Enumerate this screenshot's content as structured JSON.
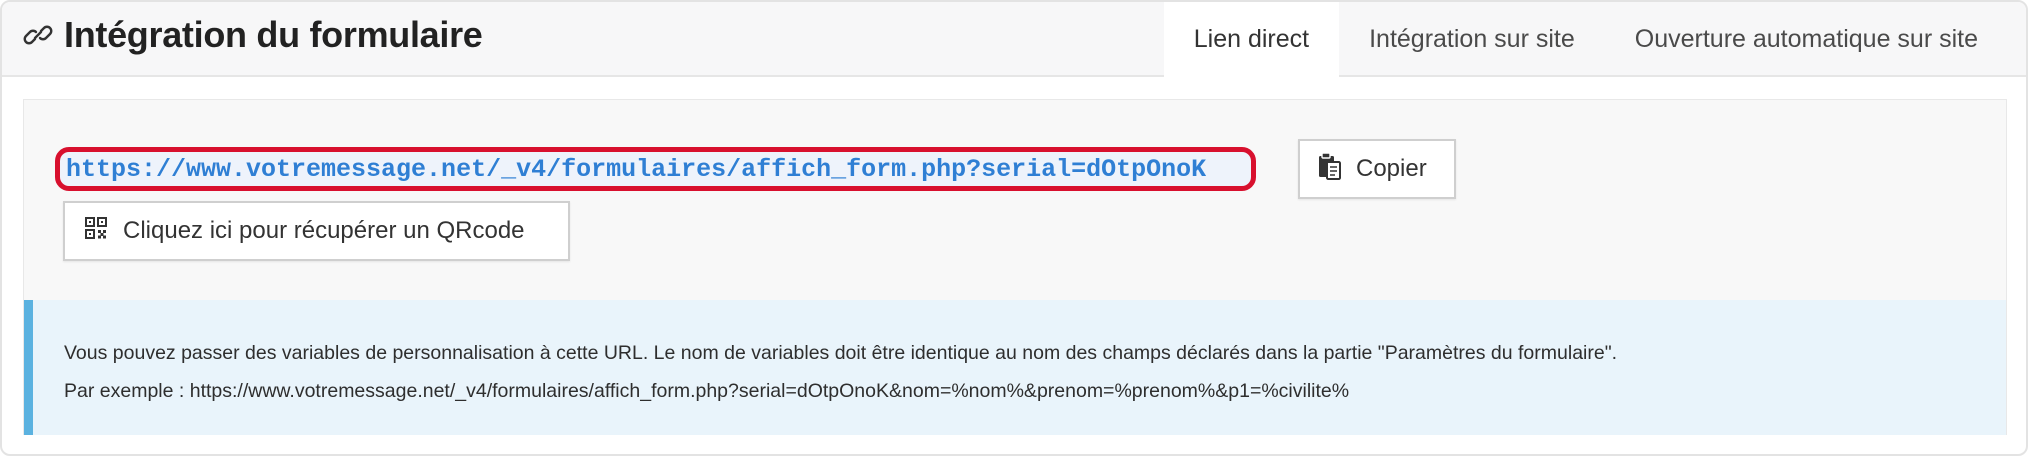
{
  "header": {
    "title": "Intégration du formulaire",
    "title_icon": "link-icon"
  },
  "tabs": [
    {
      "label": "Lien direct",
      "active": true
    },
    {
      "label": "Intégration sur site",
      "active": false
    },
    {
      "label": "Ouverture automatique sur site",
      "active": false
    }
  ],
  "direct_link": {
    "url": "https://www.votremessage.net/_v4/formulaires/affich_form.php?serial=dOtpOnoK",
    "highlight_color": "#d8102e",
    "url_color": "#2f7fd4"
  },
  "buttons": {
    "copy": {
      "label": "Copier",
      "icon": "clipboard-icon"
    },
    "qrcode": {
      "label": "Cliquez ici pour récupérer un QRcode",
      "icon": "qrcode-icon"
    }
  },
  "info": {
    "line1": "Vous pouvez passer des variables de personnalisation à cette URL. Le nom de variables doit être identique au nom des champs déclarés dans la partie \"Paramètres du formulaire\".",
    "line2": "Par exemple : https://www.votremessage.net/_v4/formulaires/affich_form.php?serial=dOtpOnoK&nom=%nom%&prenom=%prenom%&p1=%civilite%",
    "accent_color": "#5bb2e0",
    "background_color": "#e9f4fb"
  }
}
